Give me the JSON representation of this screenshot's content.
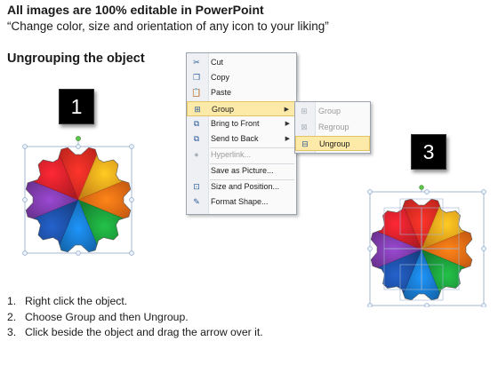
{
  "header": {
    "headline": "All images are 100% editable in PowerPoint",
    "subline": "“Change color, size and orientation of any icon to your liking”"
  },
  "section_title": "Ungrouping the object",
  "steps": [
    "1",
    "2",
    "3"
  ],
  "context_menu": {
    "items": [
      {
        "label": "Cut",
        "icon": "scissors-icon",
        "glyph": "✂",
        "submenu": false
      },
      {
        "label": "Copy",
        "icon": "copy-icon",
        "glyph": "❐",
        "submenu": false
      },
      {
        "label": "Paste",
        "icon": "paste-icon",
        "glyph": "📋",
        "submenu": false
      },
      {
        "label": "Group",
        "icon": "group-icon",
        "glyph": "⊞",
        "submenu": true,
        "highlighted": true
      },
      {
        "label": "Bring to Front",
        "icon": "bring-to-front-icon",
        "glyph": "⧉",
        "submenu": true
      },
      {
        "label": "Send to Back",
        "icon": "send-to-back-icon",
        "glyph": "⧉",
        "submenu": true
      },
      {
        "label": "Hyperlink...",
        "icon": "hyperlink-icon",
        "glyph": "●",
        "submenu": false,
        "disabled": true
      },
      {
        "label": "Save as Picture...",
        "icon": "",
        "glyph": "",
        "submenu": false
      },
      {
        "label": "Size and Position...",
        "icon": "size-position-icon",
        "glyph": "⊡",
        "submenu": false
      },
      {
        "label": "Format Shape...",
        "icon": "format-shape-icon",
        "glyph": "✎",
        "submenu": false
      }
    ]
  },
  "group_submenu": {
    "items": [
      {
        "label": "Group",
        "icon": "group-icon",
        "glyph": "⊞",
        "disabled": true
      },
      {
        "label": "Regroup",
        "icon": "regroup-icon",
        "glyph": "⊠",
        "disabled": true
      },
      {
        "label": "Ungroup",
        "icon": "ungroup-icon",
        "glyph": "⊟",
        "highlighted": true
      }
    ]
  },
  "instructions": [
    {
      "num": "1.",
      "text": "Right click the object."
    },
    {
      "num": "2.",
      "text": "Choose Group and then Ungroup."
    },
    {
      "num": "3.",
      "text": "Click beside the object and drag the arrow over it."
    }
  ],
  "gear_colors": [
    "#e52a22",
    "#f7a21b",
    "#f06a14",
    "#1c9b3a",
    "#1877c9",
    "#1d4ea3",
    "#7c3aa8",
    "#d8202a"
  ],
  "accent_colors": {
    "menu_highlight": "#fde9a8",
    "selection_handle": "#8fa8c8",
    "rotate_handle": "#5fc24a"
  }
}
